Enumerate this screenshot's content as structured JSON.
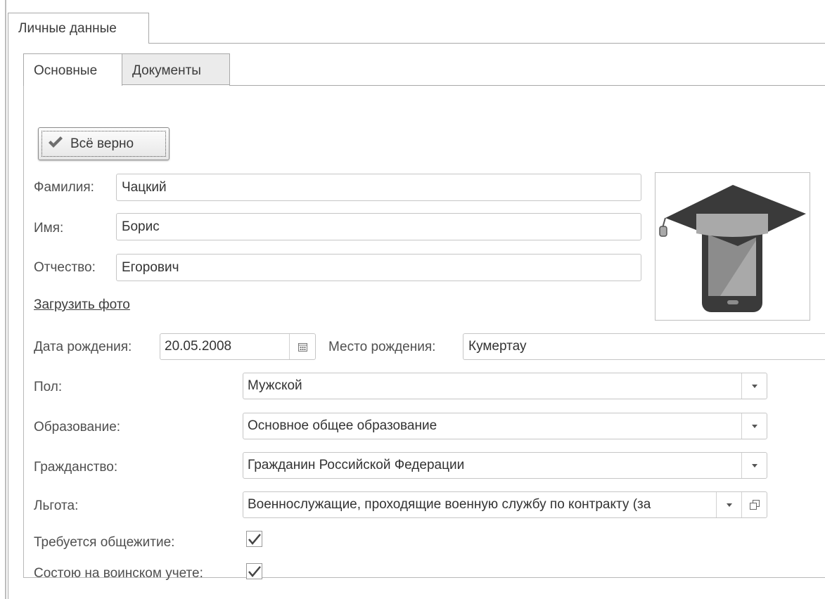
{
  "tabs": {
    "outer": "Личные данные",
    "inner": [
      "Основные",
      "Документы"
    ]
  },
  "actions": {
    "confirm_label": "Всё верно"
  },
  "fields": {
    "last_name": {
      "label": "Фамилия:",
      "value": "Чацкий"
    },
    "first_name": {
      "label": "Имя:",
      "value": "Борис"
    },
    "patronymic": {
      "label": "Отчество:",
      "value": "Егорович"
    },
    "upload_photo": "Загрузить фото",
    "birth_date": {
      "label": "Дата рождения:",
      "value": "20.05.2008"
    },
    "birth_place": {
      "label": "Место рождения:",
      "value": "Кумертау"
    },
    "gender": {
      "label": "Пол:",
      "value": "Мужской"
    },
    "education": {
      "label": "Образование:",
      "value": "Основное общее образование"
    },
    "citizenship": {
      "label": "Гражданство:",
      "value": "Гражданин Российской Федерации"
    },
    "benefit": {
      "label": "Льгота:",
      "value": "Военнослужащие, проходящие военную службу по контракту (за"
    },
    "dormitory": {
      "label": "Требуется общежитие:",
      "checked": true
    },
    "military": {
      "label": "Состою на воинском учете:",
      "checked": true
    }
  },
  "icons": {
    "confirm": "checkmark-icon",
    "calendar": "calendar-icon",
    "dropdown": "chevron-down-icon",
    "open": "open-form-icon",
    "photo": "graduate-phone-image"
  },
  "colors": {
    "photo_cap": "#3a3a3a",
    "photo_band": "#a9a9a9",
    "photo_screen": "#8c8c8c"
  }
}
